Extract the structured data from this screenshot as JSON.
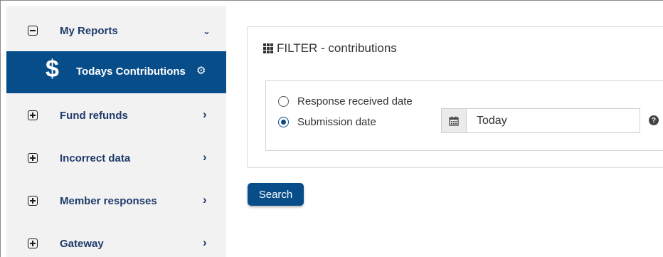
{
  "sidebar": {
    "items": [
      {
        "label": "My Reports",
        "chevron": "⌄"
      },
      {
        "label": "Todays Contributions"
      },
      {
        "label": "Fund refunds",
        "chevron": "›"
      },
      {
        "label": "Incorrect data",
        "chevron": "›"
      },
      {
        "label": "Member responses",
        "chevron": "›"
      },
      {
        "label": "Gateway",
        "chevron": "›"
      }
    ],
    "active_icon": "$",
    "gear_icon": "⚙"
  },
  "filter": {
    "title": "FILTER - contributions",
    "options": [
      {
        "label": "Response received date",
        "checked": false
      },
      {
        "label": "Submission date",
        "checked": true
      }
    ],
    "date_value": "Today",
    "calendar_glyph": "📅",
    "help_glyph": "?"
  },
  "search_label": "Search",
  "colors": {
    "primary": "#074d8a",
    "nav_text": "#1f3b6b",
    "sidebar_bg": "#f2f2f2"
  }
}
